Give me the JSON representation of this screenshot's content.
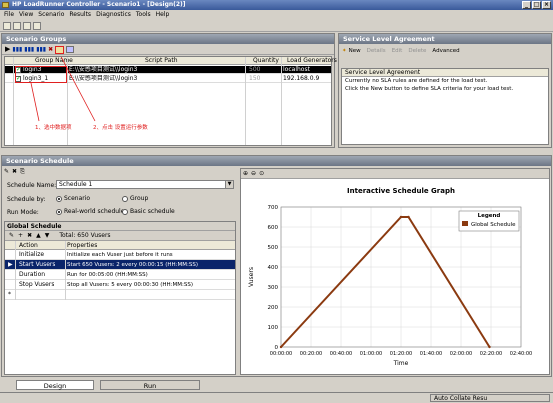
{
  "window": {
    "title": "HP LoadRunner Controller - Scenario1 - [Design(2)]"
  },
  "menu": [
    "File",
    "View",
    "Scenario",
    "Results",
    "Diagnostics",
    "Tools",
    "Help"
  ],
  "scenario_groups": {
    "title": "Scenario Groups",
    "columns": [
      "Group Name",
      "Script Path",
      "Quantity",
      "Load Generators"
    ],
    "rows": [
      {
        "name": "login3",
        "path": "E:\\\\安感项目测试\\\\login3",
        "qty": "500",
        "lg": "localhost",
        "selected": true
      },
      {
        "name": "login3_1",
        "path": "E:\\\\安感项目测试\\\\login3",
        "qty": "150",
        "lg": "192.168.0.9",
        "selected": false
      }
    ],
    "annotation1": "1、选中数据项",
    "annotation2": "2、点击  设置运行参数"
  },
  "sla": {
    "title": "Service Level Agreement",
    "buttons": {
      "new": "New",
      "details": "Details",
      "edit": "Edit",
      "delete": "Delete",
      "advanced": "Advanced"
    },
    "box_title": "Service Level Agreement",
    "line1": "Currently no SLA rules are defined for the load test.",
    "line2": "Click the New button to define SLA criteria for your load test."
  },
  "schedule": {
    "title": "Scenario Schedule",
    "name_label": "Schedule Name:",
    "name_value": "Schedule 1",
    "by_label": "Schedule by:",
    "by_scenario": "Scenario",
    "by_group": "Group",
    "mode_label": "Run Mode:",
    "mode_real": "Real-world schedule",
    "mode_basic": "Basic schedule",
    "global_title": "Global Schedule",
    "total": "Total: 650 Vusers",
    "action_header": "Action",
    "props_header": "Properties",
    "actions": [
      {
        "action": "Initialize",
        "props": "Initialize each Vuser just before it runs",
        "selected": false
      },
      {
        "action": "Start Vusers",
        "props": "Start 650 Vusers: 2 every 00:00:15 (HH:MM:SS)",
        "selected": true
      },
      {
        "action": "Duration",
        "props": "Run for 00:05:00 (HH:MM:SS)",
        "selected": false
      },
      {
        "action": "Stop Vusers",
        "props": "Stop all Vusers: 5 every 00:00:30 (HH:MM:SS)",
        "selected": false
      }
    ],
    "new_row_marker": "*"
  },
  "chart_data": {
    "type": "line",
    "title": "Interactive Schedule Graph",
    "xlabel": "Time",
    "ylabel": "Vusers",
    "ylim": [
      0,
      700
    ],
    "yticks": [
      "0",
      "100",
      "200",
      "300",
      "400",
      "500",
      "600",
      "700"
    ],
    "xticks": [
      "00:00:00",
      "00:20:00",
      "00:40:00",
      "01:00:00",
      "01:20:00",
      "01:40:00",
      "02:00:00",
      "02:20:00",
      "02:40:00"
    ],
    "xlim_min": [
      0,
      160
    ],
    "legend_title": "Legend",
    "series": [
      {
        "name": "Global Schedule",
        "color": "#8b3a10",
        "x_min": [
          0,
          80,
          85,
          139
        ],
        "y": [
          0,
          650,
          650,
          0
        ]
      }
    ]
  },
  "tabs": {
    "design": "Design",
    "run": "Run"
  },
  "status": {
    "auto_collate": "Auto Collate Resu"
  }
}
